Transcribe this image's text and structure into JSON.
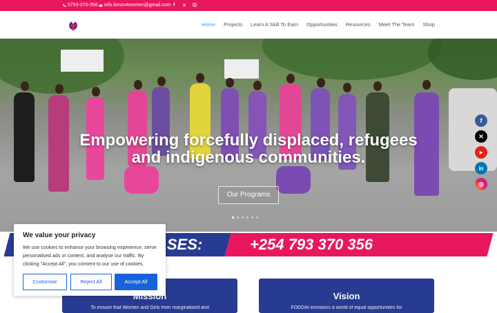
{
  "topbar": {
    "phone": "0793-370-356",
    "email": "info.forum4women@gmail.com"
  },
  "nav": {
    "items": [
      "Home",
      "Projects",
      "Learn A Skill To Earn",
      "Opportunities",
      "Resources",
      "Meet The Team",
      "Shop"
    ],
    "active": "Home"
  },
  "hero": {
    "title_line1": "Empowering forcefully displaced, refugees",
    "title_line2": "and indigenous communities.",
    "button": "Our Programs",
    "slides": 6,
    "active_slide": 1
  },
  "banner": {
    "left_text": "ASES:",
    "phone": "+254 793 370 356"
  },
  "cards": [
    {
      "title": "Mission",
      "text": "To ensure that Women and Girls from marginalized and"
    },
    {
      "title": "Vision",
      "text": "FODDAI envisions a world of equal opportunities for"
    }
  ],
  "cookie": {
    "title": "We value your privacy",
    "text": "We use cookies to enhance your browsing experience, serve personalised ads or content, and analyse our traffic. By clicking \"Accept All\", you consent to our use of cookies.",
    "customise": "Customise",
    "reject": "Reject All",
    "accept": "Accept All"
  },
  "social_side": [
    "facebook-icon",
    "x-icon",
    "youtube-icon",
    "linkedin-icon",
    "instagram-icon"
  ],
  "colors": {
    "pink": "#e8175d",
    "navy": "#283b93",
    "link": "#2ea3f2",
    "cookie_blue": "#1863dc"
  }
}
